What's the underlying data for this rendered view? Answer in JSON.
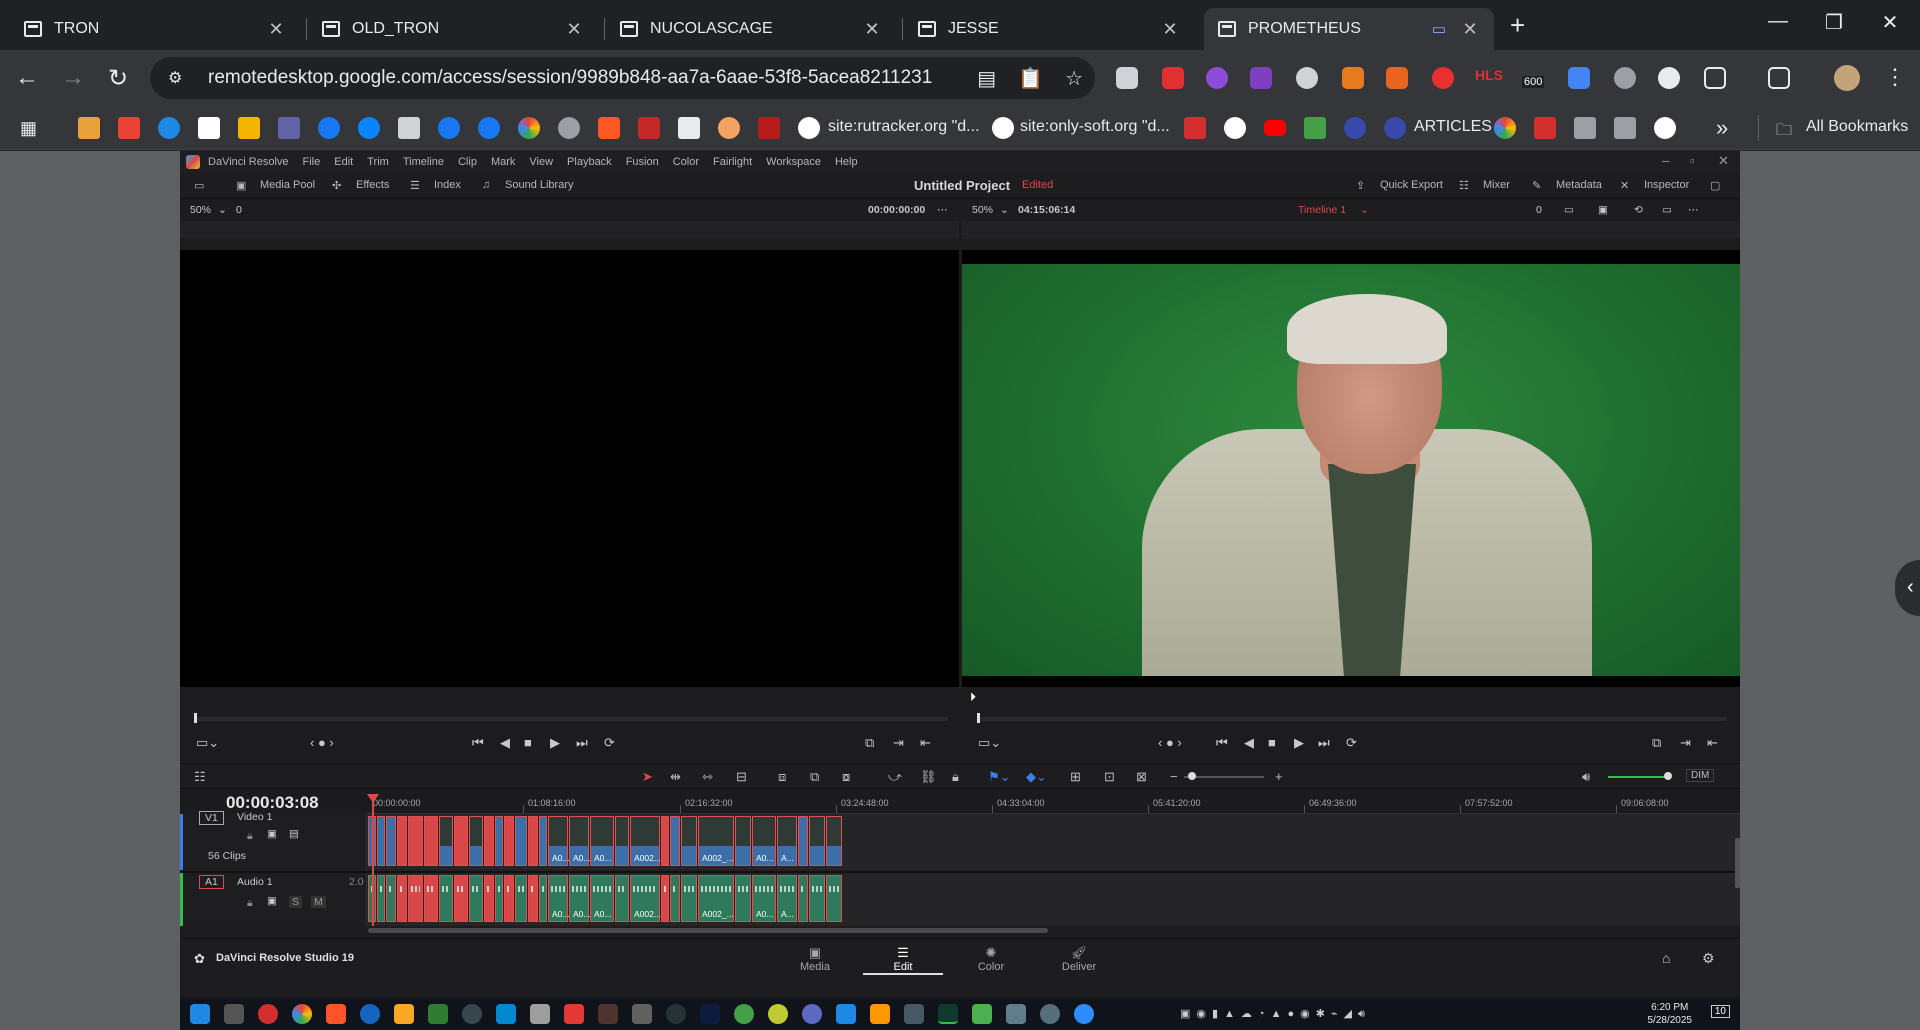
{
  "browser": {
    "tabs": [
      {
        "title": "TRON"
      },
      {
        "title": "OLD_TRON"
      },
      {
        "title": "NUCOLASCAGE"
      },
      {
        "title": "JESSE"
      },
      {
        "title": "PROMETHEUS",
        "active": true
      }
    ],
    "url": "remotedesktop.google.com/access/session/9989b848-aa7a-6aae-53f8-5acea8211231",
    "bookmarks": {
      "rutracker": "site:rutracker.org \"d...",
      "onlysoft": "site:only-soft.org \"d...",
      "articles": "ARTICLES",
      "all_bookmarks": "All Bookmarks"
    },
    "extension_badge": "600",
    "hls_label": "HLS"
  },
  "resolve": {
    "app_name": "DaVinci Resolve",
    "menu": [
      "File",
      "Edit",
      "Trim",
      "Timeline",
      "Clip",
      "Mark",
      "View",
      "Playback",
      "Fusion",
      "Color",
      "Fairlight",
      "Workspace",
      "Help"
    ],
    "toolbar": {
      "media_pool": "Media Pool",
      "effects": "Effects",
      "index": "Index",
      "sound_library": "Sound Library",
      "project_title": "Untitled Project",
      "edited": "Edited",
      "quick_export": "Quick Export",
      "mixer": "Mixer",
      "metadata": "Metadata",
      "inspector": "Inspector"
    },
    "source_viewer": {
      "zoom": "50%",
      "zoom_value": "0",
      "timecode": "00:00:00:00"
    },
    "program_viewer": {
      "zoom": "50%",
      "timecode": "04:15:06:14",
      "timeline": "Timeline 1",
      "value": "0"
    },
    "timeline": {
      "current_timecode": "00:00:03:08",
      "ruler": [
        "00:00:00:00",
        "01:08:16:00",
        "02:16:32:00",
        "03:24:48:00",
        "04:33:04:00",
        "05:41:20:00",
        "06:49:36:00",
        "07:57:52:00",
        "09:06:08:00"
      ],
      "video_track": {
        "id": "V1",
        "name": "Video 1",
        "clips_count": "56 Clips"
      },
      "audio_track": {
        "id": "A1",
        "name": "Audio 1",
        "channels": "2.0"
      },
      "clip_labels": {
        "a0": "A0...",
        "a002": "A002...",
        "a002b": "A002_...",
        "a": "A..."
      },
      "audio_buttons": {
        "solo": "S",
        "mute": "M"
      },
      "dim": "DIM"
    },
    "pages": [
      {
        "label": "Media"
      },
      {
        "label": "Edit",
        "active": true
      },
      {
        "label": "Color"
      },
      {
        "label": "Deliver"
      }
    ],
    "brand": "DaVinci Resolve Studio 19"
  },
  "taskbar": {
    "time": "6:20 PM",
    "date": "5/28/2025",
    "notification_count": "10"
  },
  "colors": {
    "accent_red": "#e04848",
    "clip_red": "#d94848",
    "clip_blue": "#3c6fa8",
    "clip_green": "#2f7a5c",
    "chroma_green": "#1f6f30"
  }
}
